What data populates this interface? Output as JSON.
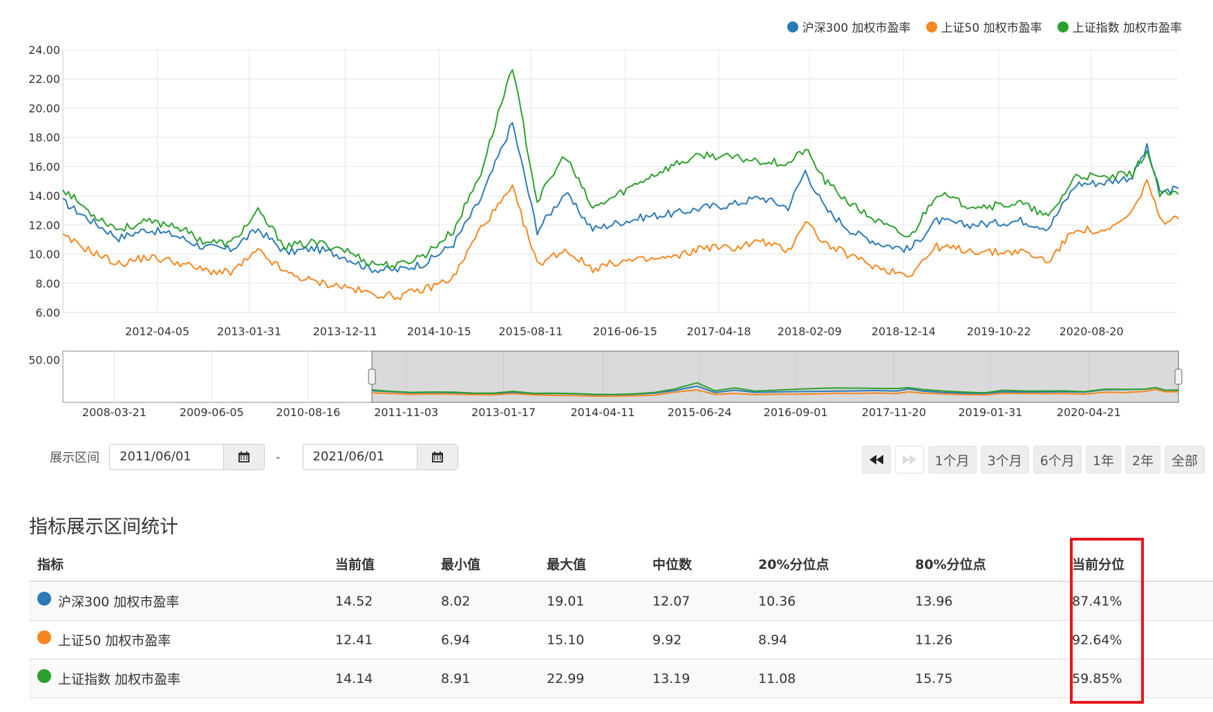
{
  "chart_data": {
    "type": "line",
    "main": {
      "x_ticks": [
        "2012-04-05",
        "2013-01-31",
        "2013-12-11",
        "2014-10-15",
        "2015-08-11",
        "2016-06-15",
        "2017-04-18",
        "2018-02-09",
        "2018-12-14",
        "2019-10-22",
        "2020-08-20"
      ],
      "y_ticks": [
        "24.00",
        "22.00",
        "20.00",
        "18.00",
        "16.00",
        "14.00",
        "12.00",
        "10.00",
        "8.00",
        "6.00"
      ],
      "ylim": [
        6,
        24
      ],
      "grid": true
    },
    "navigator": {
      "x_ticks": [
        "2008-03-21",
        "2009-06-05",
        "2010-08-16",
        "2011-11-03",
        "2013-01-17",
        "2014-04-11",
        "2015-06-24",
        "2016-09-01",
        "2017-11-20",
        "2019-01-31",
        "2020-04-21"
      ],
      "y_ticks": [
        "50.00"
      ],
      "ylim": [
        0,
        60
      ]
    },
    "x": [
      "2011-06-01",
      "2011-09-01",
      "2011-12-01",
      "2012-03-01",
      "2012-06-01",
      "2012-09-01",
      "2012-12-01",
      "2013-03-01",
      "2013-06-01",
      "2013-09-01",
      "2013-12-01",
      "2014-03-01",
      "2014-06-01",
      "2014-09-01",
      "2014-12-01",
      "2015-03-01",
      "2015-06-12",
      "2015-09-01",
      "2015-12-01",
      "2016-03-01",
      "2016-06-01",
      "2016-09-01",
      "2016-12-01",
      "2017-03-01",
      "2017-06-01",
      "2017-09-01",
      "2017-12-01",
      "2018-01-26",
      "2018-04-01",
      "2018-07-01",
      "2018-10-01",
      "2019-01-03",
      "2019-04-01",
      "2019-07-01",
      "2019-10-01",
      "2020-01-01",
      "2020-04-01",
      "2020-07-01",
      "2020-10-01",
      "2021-01-01",
      "2021-02-18",
      "2021-04-01",
      "2021-06-01"
    ],
    "series": [
      {
        "name": "沪深300 加权市盈率",
        "color": "#2a7ab8",
        "values": [
          13.6,
          12.3,
          11.1,
          11.7,
          11.3,
          10.5,
          10.3,
          11.7,
          10.1,
          10.4,
          9.9,
          9.0,
          8.9,
          9.4,
          10.7,
          13.8,
          19.0,
          11.6,
          14.2,
          11.7,
          12.2,
          12.6,
          12.8,
          13.2,
          13.4,
          13.9,
          13.2,
          15.7,
          13.1,
          11.5,
          10.7,
          10.3,
          12.3,
          12.0,
          12.1,
          12.3,
          11.8,
          14.8,
          14.9,
          15.3,
          17.3,
          14.2,
          14.5
        ]
      },
      {
        "name": "上证50 加权市盈率",
        "color": "#f6861f",
        "values": [
          11.2,
          10.2,
          9.3,
          9.8,
          9.5,
          8.9,
          8.7,
          10.2,
          8.7,
          8.1,
          7.8,
          7.3,
          7.1,
          7.6,
          8.4,
          11.8,
          14.5,
          9.3,
          10.3,
          9.0,
          9.5,
          9.6,
          9.8,
          10.5,
          10.4,
          10.9,
          10.2,
          12.3,
          10.7,
          9.8,
          9.0,
          8.6,
          10.5,
          10.3,
          10.1,
          10.2,
          9.5,
          11.8,
          11.4,
          12.8,
          15.1,
          12.3,
          12.4
        ]
      },
      {
        "name": "上证指数 加权市盈率",
        "color": "#2ca02c",
        "values": [
          14.5,
          12.8,
          11.7,
          12.2,
          12.0,
          10.9,
          10.7,
          12.9,
          10.5,
          10.8,
          10.4,
          9.4,
          9.2,
          10.0,
          11.6,
          15.6,
          22.9,
          13.6,
          16.8,
          13.1,
          14.2,
          15.3,
          16.2,
          16.8,
          16.6,
          16.4,
          16.2,
          17.2,
          15.0,
          13.3,
          12.1,
          11.1,
          14.2,
          13.4,
          13.3,
          13.5,
          12.5,
          15.4,
          15.2,
          15.5,
          17.1,
          14.1,
          14.1
        ]
      }
    ]
  },
  "controls": {
    "range_label": "展示区间",
    "start_date": "2011/06/01",
    "end_date": "2021/06/01",
    "dash": "-",
    "buttons": [
      "1个月",
      "3个月",
      "6个月",
      "1年",
      "2年",
      "全部"
    ]
  },
  "stats": {
    "title": "指标展示区间统计",
    "headers": [
      "指标",
      "当前值",
      "最小值",
      "最大值",
      "中位数",
      "20%分位点",
      "80%分位点",
      "当前分位"
    ],
    "rows": [
      {
        "name": "沪深300 加权市盈率",
        "color": "#2a7ab8",
        "cells": [
          "14.52",
          "8.02",
          "19.01",
          "12.07",
          "10.36",
          "13.96",
          "87.41%"
        ]
      },
      {
        "name": "上证50 加权市盈率",
        "color": "#f6861f",
        "cells": [
          "12.41",
          "6.94",
          "15.10",
          "9.92",
          "8.94",
          "11.26",
          "92.64%"
        ]
      },
      {
        "name": "上证指数 加权市盈率",
        "color": "#2ca02c",
        "cells": [
          "14.14",
          "8.91",
          "22.99",
          "13.19",
          "11.08",
          "15.75",
          "59.85%"
        ]
      }
    ]
  },
  "colors": {
    "highlight": "#e8151b"
  }
}
